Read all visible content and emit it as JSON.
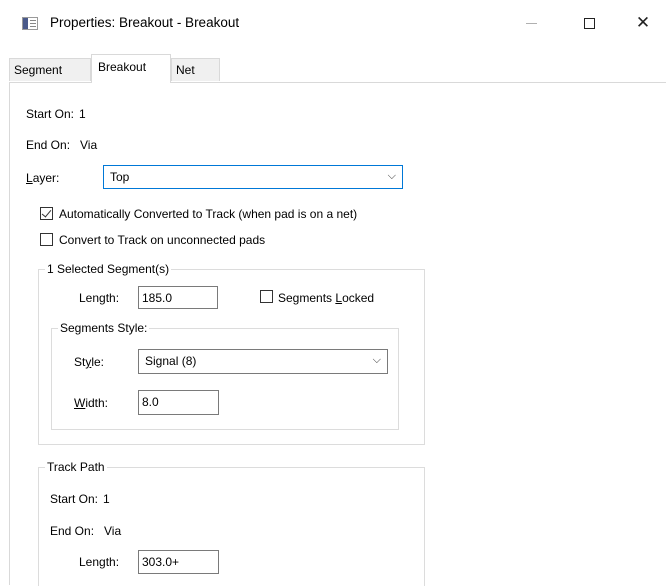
{
  "window": {
    "title": "Properties: Breakout - Breakout",
    "minimize_symbol": "—",
    "close_symbol": "✕"
  },
  "tabs": [
    {
      "label": "Segment",
      "active": false
    },
    {
      "label": "Breakout",
      "active": true
    },
    {
      "label": "Net",
      "active": false
    }
  ],
  "breakout": {
    "start_on_label": "Start On:",
    "start_on_value": "1",
    "end_on_label": "End On:",
    "end_on_value": "Via",
    "layer_label_mnemonic": "L",
    "layer_label_rest": "ayer:",
    "layer_value": "Top",
    "auto_convert_label": "Automatically Converted to Track (when pad is on a net)",
    "auto_convert_checked": true,
    "convert_unconnected_label": "Convert to Track on unconnected pads",
    "convert_unconnected_checked": false
  },
  "selected_segments": {
    "group_title": "1 Selected Segment(s)",
    "length_label": "Length:",
    "length_value": "185.0",
    "locked_label_pre": "Segments ",
    "locked_label_mnemonic": "L",
    "locked_label_post": "ocked",
    "locked_checked": false,
    "style_group_title": "Segments Style:",
    "style_label_pre": "St",
    "style_label_mnemonic": "y",
    "style_label_post": "le:",
    "style_value": "Signal (8)",
    "width_label_mnemonic": "W",
    "width_label_rest": "idth:",
    "width_value": "8.0"
  },
  "track_path": {
    "group_title": "Track Path",
    "start_on_label": "Start On:",
    "start_on_value": "1",
    "end_on_label": "End On:",
    "end_on_value": "Via",
    "length_label": "Length:",
    "length_value": "303.0+"
  },
  "icons": {
    "chevron": "⌵"
  }
}
